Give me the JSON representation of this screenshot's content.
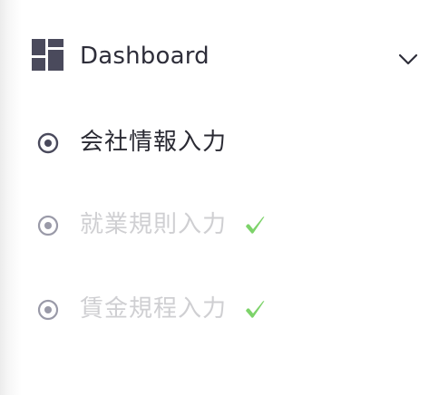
{
  "header": {
    "icon": "dashboard-icon",
    "label": "Dashboard",
    "toggle_icon": "chevron-down-icon"
  },
  "nav": {
    "items": [
      {
        "label": "会社情報入力",
        "icon": "radio-dot-icon",
        "state": "active",
        "completed": false
      },
      {
        "label": "就業規則入力",
        "icon": "radio-dot-icon",
        "state": "muted",
        "completed": true
      },
      {
        "label": "賃金規程入力",
        "icon": "radio-dot-icon",
        "state": "muted",
        "completed": true
      }
    ]
  },
  "colors": {
    "active_text": "#2a2a33",
    "muted_text": "#cfcfd2",
    "icon_dark": "#4a4a5c",
    "icon_muted": "#9a9aa8",
    "check_green": "#7dd36a"
  }
}
